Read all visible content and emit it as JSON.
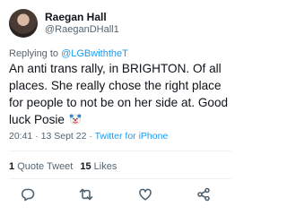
{
  "tweet": {
    "display_name": "Raegan Hall",
    "handle": "@RaeganDHall1",
    "reply_prefix": "Replying to ",
    "reply_to": "@LGBwiththeT",
    "text": "An anti trans rally, in BRIGHTON. Of all places. She really chose the right place for people to not be on her side at. Good luck Posie",
    "emoji": "clown-face-emoji",
    "time": "20:41",
    "date": "13 Sept 22",
    "separator": " · ",
    "source": "Twitter for iPhone"
  },
  "stats": {
    "quote_count": "1",
    "quote_label": "Quote Tweet",
    "like_count": "15",
    "like_label": "Likes"
  },
  "actions": [
    "reply-icon",
    "retweet-icon",
    "like-icon",
    "share-icon"
  ],
  "colors": {
    "text": "#0f1419",
    "secondary": "#536471",
    "link": "#1d9bf0",
    "divider": "#eff3f4"
  }
}
